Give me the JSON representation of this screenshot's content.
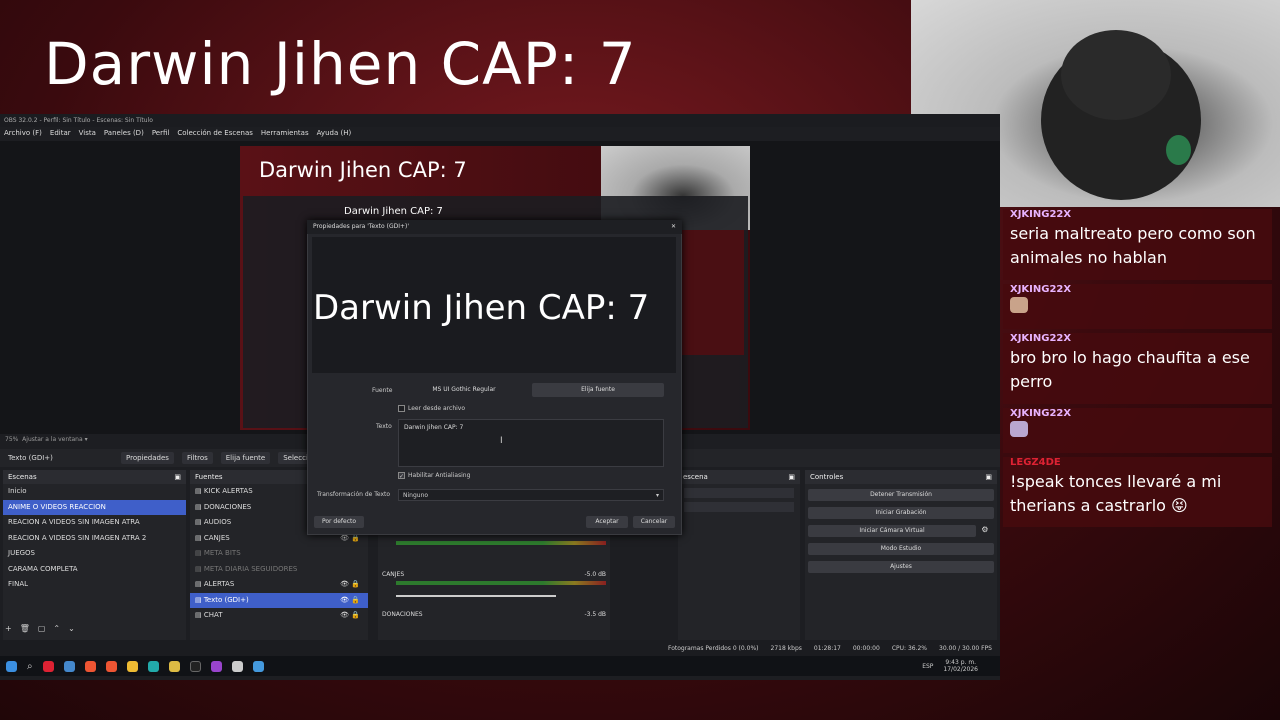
{
  "overlay": {
    "title": "Darwin Jihen CAP: 7"
  },
  "obs": {
    "window_title": "OBS 32.0.2 - Perfil: Sin Título - Escenas: Sin Título",
    "menu": [
      "Archivo (F)",
      "Editar",
      "Vista",
      "Paneles (D)",
      "Perfil",
      "Colección de Escenas",
      "Herramientas",
      "Ayuda (H)"
    ],
    "preview_title": "Darwin Jihen CAP: 7",
    "preview_inner_title": "Darwin Jihen CAP: 7",
    "zoom": "75%",
    "zoom_label": "Ajustar a la ventana",
    "source_toolbar": {
      "selected": "Texto (GDI+)",
      "properties": "Propiedades",
      "filters": "Filtros",
      "font": "Elija fuente",
      "select": "Selecci"
    },
    "scenes": {
      "header": "Escenas",
      "items": [
        "Inicio",
        "ANIME O VIDEOS REACCION",
        "REACION A VIDEOS SIN IMAGEN ATRA",
        "REACION A VIDEOS SIN IMAGEN ATRA 2",
        "JUEGOS",
        "CARAMA COMPLETA",
        "FINAL"
      ],
      "selected": 1
    },
    "sources": {
      "header": "Fuentes",
      "items": [
        "KICK ALERTAS",
        "DONACIONES",
        "AUDIOS",
        "CANJES",
        "META BITS",
        "META DIARIA SEGUIDORES",
        "ALERTAS",
        "Texto (GDI+)",
        "CHAT"
      ],
      "selected": 7,
      "dimmed": [
        4,
        5
      ]
    },
    "mixer": {
      "channels": [
        {
          "name": "CANJES",
          "db": "-5.0 dB"
        },
        {
          "name": "DONACIONES",
          "db": "-3.5 dB"
        }
      ]
    },
    "transitions_header": "escena",
    "controls": {
      "header": "Controles",
      "buttons": [
        "Detener Transmisión",
        "Iniciar Grabación",
        "Iniciar Cámara Virtual",
        "Modo Estudio",
        "Ajustes"
      ]
    },
    "status": {
      "dropped": "Fotogramas Perdidos 0 (0.0%)",
      "kbps": "2718 kbps",
      "live_time": "01:28:17",
      "rec_time": "00:00:00",
      "cpu": "CPU: 36.2%",
      "fps": "30.00 / 30.00 FPS"
    }
  },
  "dialog": {
    "title": "Propiedades para 'Texto (GDI+)'",
    "preview_text": "Darwin Jihen CAP: 7",
    "font_label": "Fuente",
    "font_name": "MS UI Gothic Regular",
    "font_button": "Elija fuente",
    "read_file_label": "Leer desde archivo",
    "text_label": "Texto",
    "text_value": "Darwin Jihen CAP: 7",
    "antialias_label": "Habilitar Antialiasing",
    "transform_label": "Transformación de Texto",
    "transform_value": "Ninguno",
    "defaults_button": "Por defecto",
    "accept_button": "Aceptar",
    "cancel_button": "Cancelar"
  },
  "taskbar": {
    "clock_time": "9:43 p. m.",
    "clock_date": "17/02/2026",
    "lang": "ESP"
  },
  "chat": [
    {
      "user": "XJKING22X",
      "text": "seria maltreato pero como son animales no hablan"
    },
    {
      "user": "XJKING22X",
      "text": ""
    },
    {
      "user": "XJKING22X",
      "text": "bro bro lo hago chaufita a ese perro"
    },
    {
      "user": "XJKING22X",
      "text": ""
    },
    {
      "user": "LEGZ4DE",
      "text": "!speak tonces llevaré a mi therians a castrarlo 😝"
    }
  ],
  "colors": {
    "accent": "#3f5fc9",
    "chat_user": "#e8b4ff",
    "chat_bg": "#460a0e"
  }
}
